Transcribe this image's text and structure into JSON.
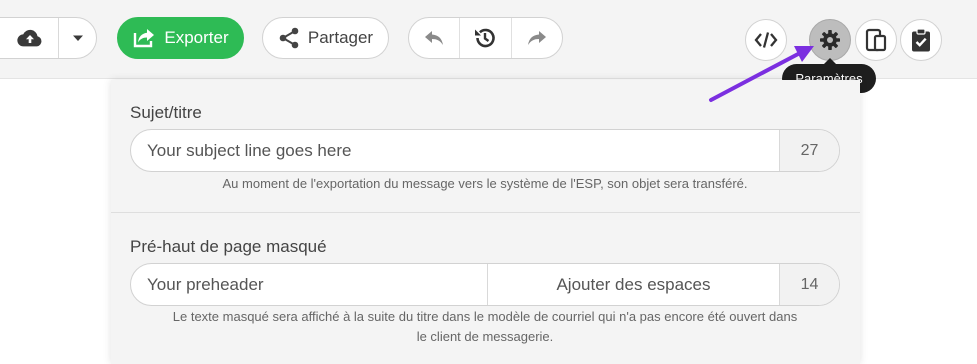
{
  "toolbar": {
    "upload_icon": "cloud-upload-icon",
    "dropdown_icon": "caret-down-icon",
    "export_label": "Exporter",
    "export_icon": "share-box-icon",
    "share_label": "Partager",
    "share_icon": "share-nodes-icon",
    "undo_icon": "undo-icon",
    "history_icon": "history-icon",
    "redo_icon": "redo-icon",
    "code_icon": "code-icon",
    "settings_icon": "gear-icon",
    "mobile_icon": "mobile-preview-icon",
    "clipboard_icon": "clipboard-check-icon",
    "settings_tooltip": "Paramètres"
  },
  "colors": {
    "accent_green": "#2ebb55",
    "annotation_arrow": "#7b2fe0",
    "tooltip_bg": "#1e1e1e"
  },
  "subject": {
    "label": "Sujet/titre",
    "value": "Your subject line goes here",
    "count": "27",
    "help": "Au moment de l'exportation du message vers le système de l'ESP, son objet sera transféré."
  },
  "preheader": {
    "label": "Pré-haut de page masqué",
    "value": "Your preheader",
    "add_spaces_label": "Ajouter des espaces",
    "count": "14",
    "help_line1": "Le texte masqué sera affiché à la suite du titre dans le modèle de courriel qui n'a pas encore été ouvert dans",
    "help_line2": "le client de messagerie."
  }
}
